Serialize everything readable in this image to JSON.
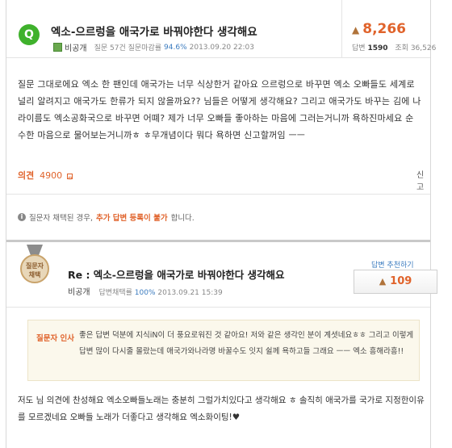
{
  "question": {
    "badge": "Q",
    "title": "엑소-으르렁을 애국가로 바꿔야한다 생각해요",
    "user": "비공개",
    "meta_prefix": "질문 57건 질문마감률",
    "close_rate": "94.6%",
    "datetime": "2013.09.20 22:03",
    "likes": "8,266",
    "answer_label": "답변",
    "answer_count": "1590",
    "view_label": "조회",
    "view_count": "36,526",
    "body": "질문 그대로에요 엑소 한 팬인데 애국가는 너무 식상한거 같아요 으르렁으로 바꾸면 엑소 오빠들도 세계로 널리 알려지고 애국가도 한류가 되지 않을까요?? 님들은 어떻게 생각해요? 그리고 애국가도 바꾸는 김에 나라이름도 엑소공화국으로 바꾸면 어뗴? 제가 너무 오빠들 좋아하는 마음에 그러는거니까 욕하진마세요 순수한 마음으로 물어보는거니까ㅎ ㅎ무개념이다 뭐다 욕하면 신고할꺼임 ㅡㅡ",
    "opinion_label": "의견",
    "opinion_count": "4900",
    "opinion_icon": "ㅁ",
    "report_label": "신고"
  },
  "notice": {
    "icon": "i",
    "prefix": "질문자 채택된 경우,",
    "highlight": "추가 답변 등록이 불가",
    "suffix": "합니다."
  },
  "answer": {
    "medal_line1": "질문자",
    "medal_line2": "채택",
    "title": "Re : 엑소-으르렁을 애국가로 바꿔야한다 생각해요",
    "user": "비공개",
    "meta_prefix": "답변채택률",
    "adopt_rate": "100%",
    "datetime": "2013.09.21 15:39",
    "recommend_label": "답변 추천하기",
    "recommend_count": "109",
    "comment_label": "질문자 인사",
    "comment_text": "좋은 답변 덕분에 지식iN이 더 풍요로워진 것 같아요! 저와 같은 생각인 분이 계셧네요ㅎㅎ 그리고 이렇게 답변 많이 다시줄 몰랐는데 애국가와나라명 바꿀수도 잇지 쉴께 욕하고들 그래요 ㅡㅡ 엑소 흥해라흥!!",
    "body": "저도 님 의견에 찬성해요 엑소오빠들노래는 충분히 그럴가치있다고 생각해요 ㅎ 솔직히 애국가를 국가로 지정한이유를 모르겠네요 오빠들 노래가 더좋다고 생각해요 엑소화이팅!♥"
  },
  "colors": {
    "accent": "#e0632b",
    "badge_green": "#3fb12c",
    "link_blue": "#3b7bbf"
  }
}
